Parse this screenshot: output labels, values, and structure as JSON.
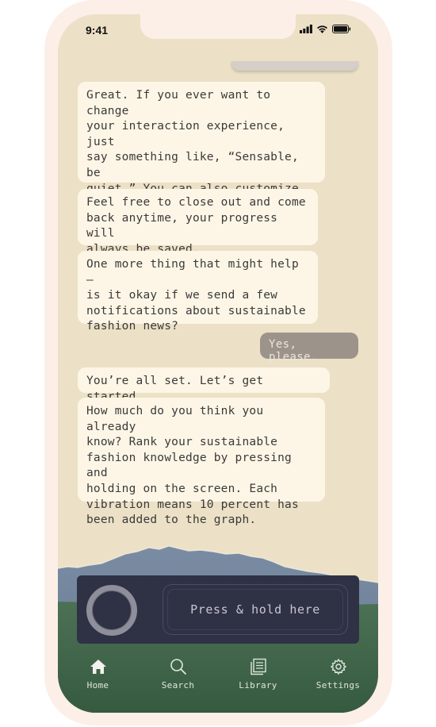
{
  "status": {
    "time": "9:41"
  },
  "chat": {
    "bot_messages": [
      "Great. If you ever want to change\nyour interaction experience, just\nsay something like, “Sensable, be\nquiet.” You can also customize\nyour experience in settings down\nbelow or just talk to us.",
      "Feel free to close out and come\nback anytime, your progress will\nalways be saved.",
      "One more thing that might help –\nis it okay if we send a few\nnotifications about sustainable\nfashion news?",
      "You’re all set. Let’s get started.",
      "How much do you think you already\nknow? Rank your sustainable\nfashion knowledge by pressing and\nholding on the screen. Each\nvibration means 10 percent has\nbeen added to the graph."
    ],
    "user_reply": "Yes, please."
  },
  "control": {
    "hold_label": "Press & hold here"
  },
  "nav": {
    "tabs": [
      {
        "label": "Home",
        "icon": "home-icon",
        "active": true
      },
      {
        "label": "Search",
        "icon": "search-icon",
        "active": false
      },
      {
        "label": "Library",
        "icon": "library-icon",
        "active": false
      },
      {
        "label": "Settings",
        "icon": "gear-icon",
        "active": false
      }
    ]
  },
  "colors": {
    "background": "#ece0c6",
    "bubble": "#fdf6e6",
    "user_bubble": "#9c948b",
    "panel": "#2f3145",
    "mountain": "#6f829a",
    "grass": "#3f6549"
  }
}
